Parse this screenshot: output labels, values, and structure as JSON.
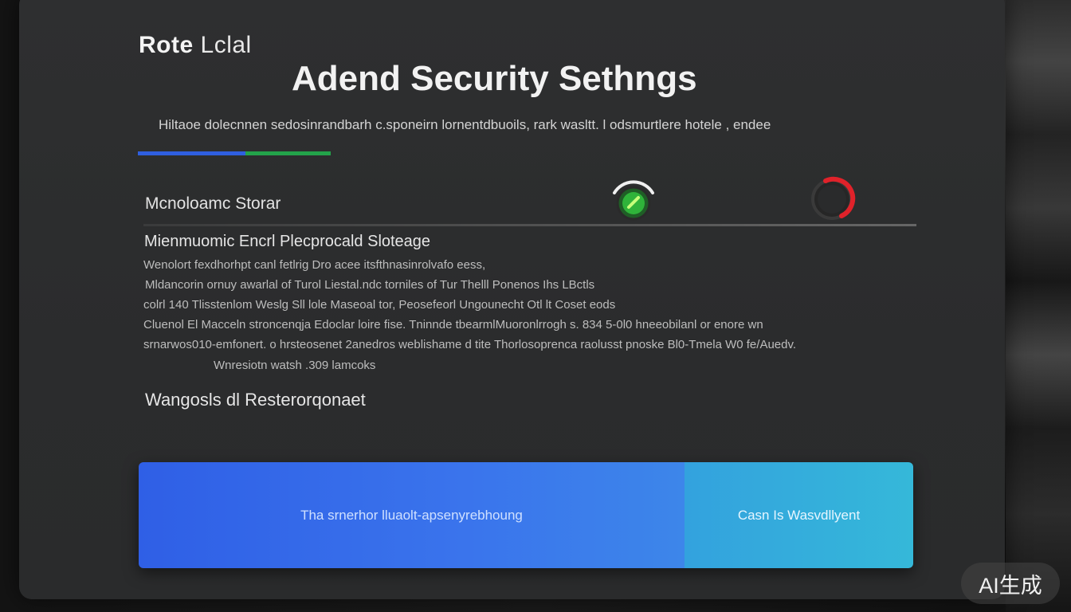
{
  "header": {
    "brand_part1": "Rote",
    "brand_part2": "Lclal",
    "title": "Adend Security Sethngs",
    "subtitle": "Hiltaoe dolecnnen sedosinrandbarh c.sponeirn lornentdbuoils,  rark wasltt.  l odsmurtlere   hotele ,  endee"
  },
  "colors": {
    "accent_blue": "#2f5fe0",
    "accent_green": "#23a34a",
    "gauge_ok": "#2fb33a",
    "gauge_alert": "#e0222a"
  },
  "settings": {
    "row1_label": "Mcnoloamc Storar",
    "row1_status_icon": "green-check-gauge",
    "row2_status_icon": "red-alert-gauge"
  },
  "section": {
    "title": "Mienmuomic Encrl Plecprocald Sloteage",
    "lines": [
      "Wenolort fexdhorhpt canl fetlrig Dro acee itsfthnasinrolvafo eess,",
      "Mldancorin ornuy awarlal of  Turol Liestal.ndc  torniles of Tur Thelll Ponenos Ihs  LBctls",
      "colrl   140  Tlisstenlom Weslg Sll lole Maseoal tor, Peosefeorl  Ungounecht  Otl  lt  Coset eods",
      "Cluenol El Macceln stroncenqja Edoclar loire  fise. Tninnde tbearmlMuoronlrrogh s.  834  5-0l0 hneeobilanl or enore wn",
      "srnarwos010-emfonert. o hrsteosenet 2anedros weblishame d tite  Thorlosoprenca raolusst pnoske Bl0-Tmela W0 fe/Auedv.",
      "Wnresiotn watsh .309 lamcoks"
    ]
  },
  "bottom": {
    "label": "Wangosls dl Resterorqonaet"
  },
  "actions": {
    "primary_label": "Tha srnerhor lluaolt-apsenyrebhoung",
    "secondary_label": "Casn Is Wasvdllyent"
  },
  "watermark": {
    "text": "AI生成"
  }
}
